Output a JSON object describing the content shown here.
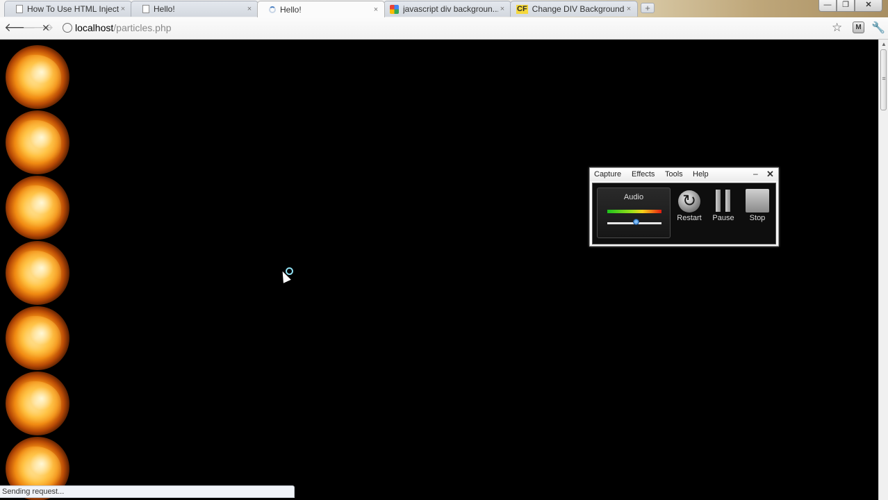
{
  "window": {
    "controls": {
      "minimize": "—",
      "maximize": "❐",
      "close": "✕"
    }
  },
  "tabs": [
    {
      "title": "How To Use HTML Inject...",
      "icon": "page-icon",
      "active": false
    },
    {
      "title": "Hello!",
      "icon": "page-icon",
      "active": false
    },
    {
      "title": "Hello!",
      "icon": "loading-spinner-icon",
      "active": true
    },
    {
      "title": "javascript div backgroun...",
      "icon": "google-icon",
      "active": false
    },
    {
      "title": "Change DIV Background ...",
      "icon": "cf-icon",
      "active": false
    }
  ],
  "tab_close_glyph": "×",
  "new_tab_glyph": "+",
  "toolbar": {
    "back": "🡐",
    "forward": "🡒",
    "stop": "✕",
    "url_host": "localhost",
    "url_path": "/particles.php",
    "star": "☆",
    "extension": "M",
    "wrench": "🔧"
  },
  "page": {
    "particle_count": 7
  },
  "recorder": {
    "menu": [
      "Capture",
      "Effects",
      "Tools",
      "Help"
    ],
    "minimize": "–",
    "close": "✕",
    "audio_label": "Audio",
    "volume_level": 0.53,
    "buttons": {
      "restart": "Restart",
      "pause": "Pause",
      "stop": "Stop"
    }
  },
  "status_text": "Sending request..."
}
